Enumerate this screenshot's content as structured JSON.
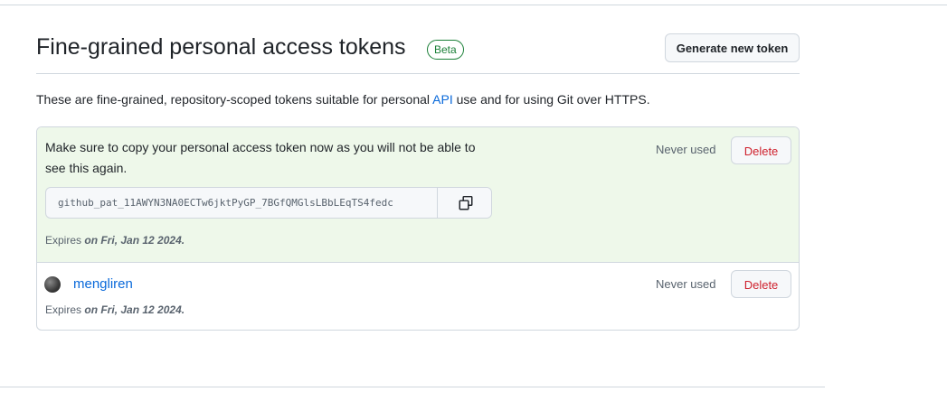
{
  "header": {
    "title": "Fine-grained personal access tokens",
    "badge": "Beta",
    "generate_button": "Generate new token"
  },
  "description": {
    "before_link": "These are fine-grained, repository-scoped tokens suitable for personal ",
    "link_text": "API",
    "after_link": " use and for using Git over HTTPS."
  },
  "new_token": {
    "notice": "Make sure to copy your personal access token now as you will not be able to see this again.",
    "token_value": "github_pat_11AWYN3NA0ECTw6jktPyGP_7BGfQMGlsLBbLEqTS4fedc",
    "usage": "Never used",
    "delete_label": "Delete",
    "expires_prefix": "Expires",
    "expires_date": "on Fri, Jan 12 2024."
  },
  "tokens": [
    {
      "name": "mengliren",
      "usage": "Never used",
      "delete_label": "Delete",
      "expires_prefix": "Expires",
      "expires_date": "on Fri, Jan 12 2024."
    }
  ],
  "icons": {
    "copy": "copy-icon",
    "avatar": "avatar"
  },
  "colors": {
    "accent_link": "#0969da",
    "danger": "#cf222e",
    "success": "#1a7f37",
    "new_token_bg": "#eef8ea"
  }
}
